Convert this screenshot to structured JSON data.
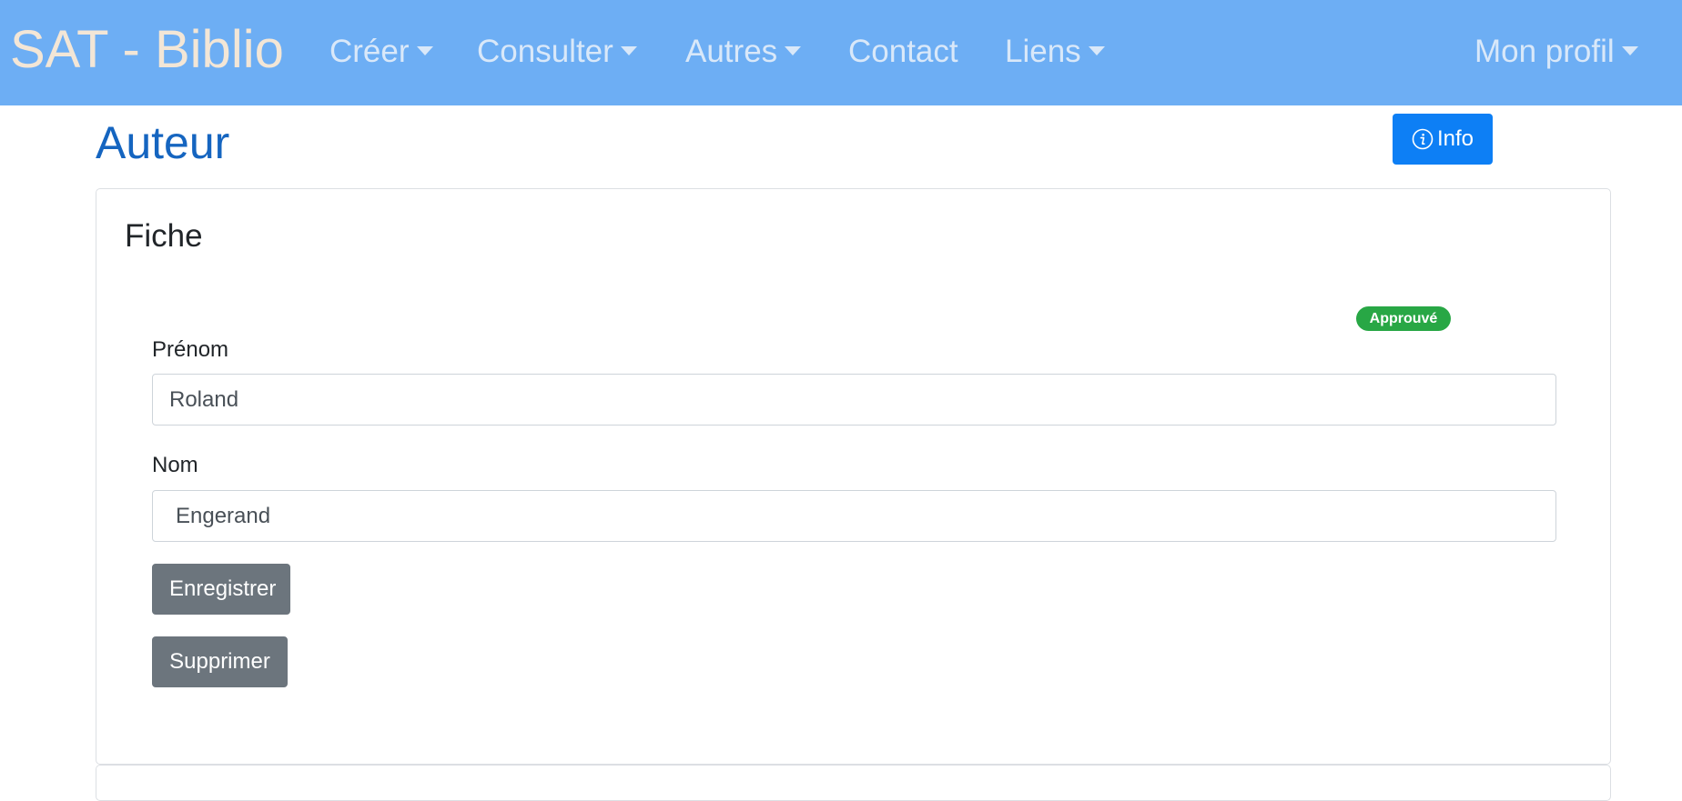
{
  "navbar": {
    "brand": "SAT - Biblio",
    "items": [
      {
        "label": "Créer",
        "dropdown": true
      },
      {
        "label": "Consulter",
        "dropdown": true
      },
      {
        "label": "Autres",
        "dropdown": true
      },
      {
        "label": "Contact",
        "dropdown": false
      },
      {
        "label": "Liens",
        "dropdown": true
      }
    ],
    "profile": {
      "label": "Mon profil",
      "dropdown": true
    }
  },
  "page": {
    "title": "Auteur",
    "info_button": {
      "label": "Info",
      "icon": "info-circle-icon"
    }
  },
  "card": {
    "title": "Fiche",
    "status_badge": "Approuvé",
    "fields": {
      "prenom": {
        "label": "Prénom",
        "value": "Roland"
      },
      "nom": {
        "label": "Nom",
        "value": "Engerand"
      }
    },
    "buttons": {
      "save": "Enregistrer",
      "delete": "Supprimer"
    }
  },
  "colors": {
    "navbar_bg": "#6daef4",
    "brand_text": "#f3e6d6",
    "nav_text": "#d9e8f9",
    "title_blue": "#1565c0",
    "info_button": "#0d7ff5",
    "badge_green": "#28a745",
    "secondary_button": "#6c757d"
  }
}
